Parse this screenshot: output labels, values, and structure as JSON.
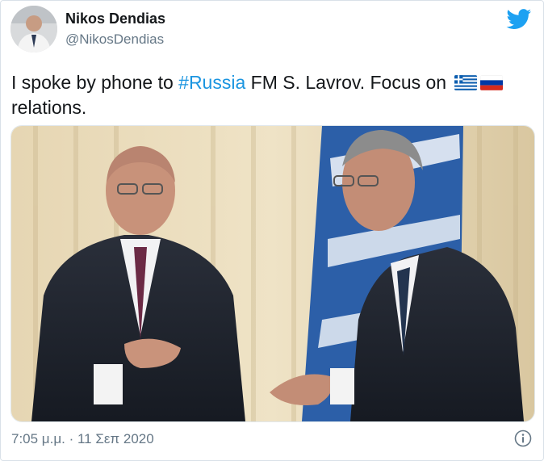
{
  "tweet": {
    "author_name": "Nikos Dendias",
    "author_handle": "@NikosDendias",
    "text_before_hashtag": "I spoke by phone to ",
    "hashtag": "#Russia",
    "text_after_hashtag": " FM S. Lavrov. Focus on ",
    "text_end": "relations.",
    "flags": [
      "greek-flag-icon",
      "russian-flag-icon"
    ],
    "timestamp": "7:05 μ.μ. · 11 Σεπ 2020",
    "icons": {
      "brand": "twitter-bird-icon",
      "info": "info-icon"
    }
  },
  "colors": {
    "hashtag": "#1b95e0",
    "twitter_blue": "#1da1f2",
    "secondary_text": "#657786"
  }
}
